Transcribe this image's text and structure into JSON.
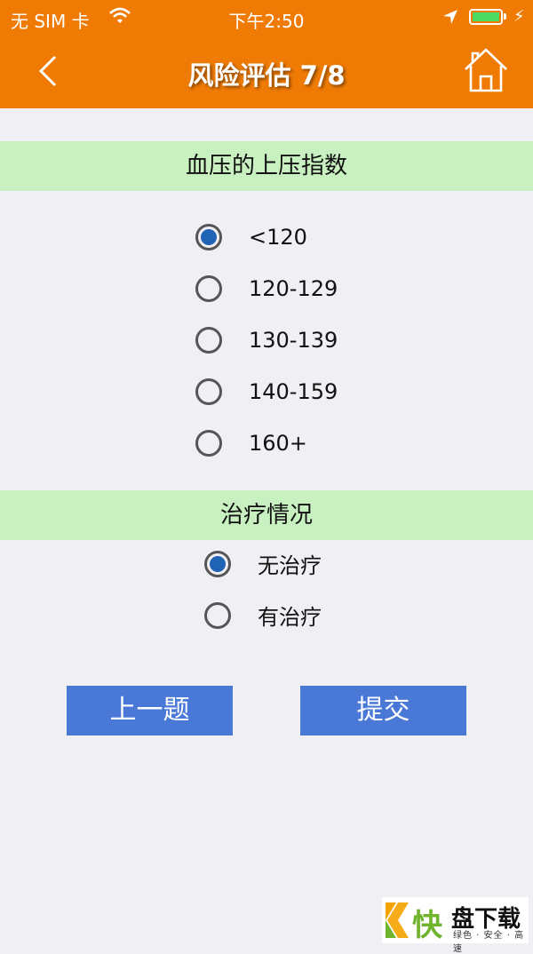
{
  "status_bar": {
    "carrier": "无 SIM 卡",
    "time": "下午2:50",
    "battery_bolt": "⚡"
  },
  "nav": {
    "title": "风险评估 7/8",
    "back_icon": "chevron-left-icon",
    "home_icon": "home-icon"
  },
  "sections": [
    {
      "title": "血压的上压指数",
      "options": [
        {
          "label": "<120",
          "selected": true
        },
        {
          "label": "120-129",
          "selected": false
        },
        {
          "label": "130-139",
          "selected": false
        },
        {
          "label": "140-159",
          "selected": false
        },
        {
          "label": "160+",
          "selected": false
        }
      ]
    },
    {
      "title": "治疗情况",
      "options": [
        {
          "label": "无治疗",
          "selected": true
        },
        {
          "label": "有治疗",
          "selected": false
        }
      ]
    }
  ],
  "buttons": {
    "prev": "上一题",
    "submit": "提交"
  },
  "watermark": {
    "char": "快",
    "name": "盘下载",
    "slogan": "绿色 · 安全 · 高速"
  },
  "colors": {
    "header": "#ef7b05",
    "section": "#c8f0c0",
    "button": "#4a78d6",
    "radio_selected": "#1f63b5"
  }
}
